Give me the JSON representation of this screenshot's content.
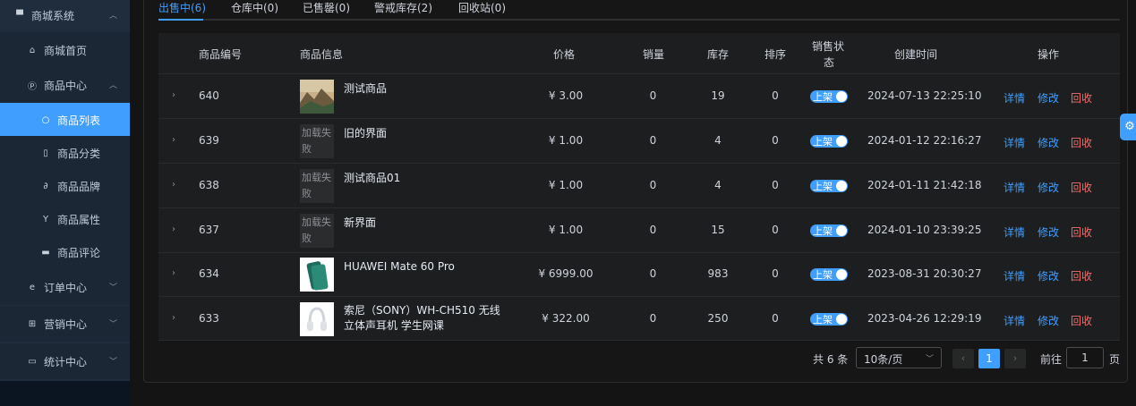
{
  "sidebar": {
    "items": [
      {
        "label": "商城系统",
        "icon": "store-icon",
        "chev": "⌃"
      },
      {
        "label": "商城首页",
        "icon": "home-icon"
      },
      {
        "label": "商品中心",
        "icon": "product-icon",
        "chev": "⌃"
      },
      {
        "label": "商品列表",
        "icon": "apple-icon"
      },
      {
        "label": "商品分类",
        "icon": "phone-icon"
      },
      {
        "label": "商品品牌",
        "icon": "link-icon"
      },
      {
        "label": "商品属性",
        "icon": "branch-icon"
      },
      {
        "label": "商品评论",
        "icon": "chat-icon"
      },
      {
        "label": "订单中心",
        "icon": "order-icon",
        "chev": "⌄"
      },
      {
        "label": "营销中心",
        "icon": "gift-icon",
        "chev": "⌄"
      },
      {
        "label": "统计中心",
        "icon": "monitor-icon",
        "chev": "⌄"
      }
    ],
    "active": "商品列表"
  },
  "tabs": [
    {
      "label": "出售中(6)",
      "active": true
    },
    {
      "label": "仓库中(0)",
      "active": false
    },
    {
      "label": "已售罄(0)",
      "active": false
    },
    {
      "label": "警戒库存(2)",
      "active": false
    },
    {
      "label": "回收站(0)",
      "active": false
    }
  ],
  "table": {
    "headers": {
      "id": "商品编号",
      "info": "商品信息",
      "price": "价格",
      "sales": "销量",
      "stock": "库存",
      "sort": "排序",
      "status_line1": "销售状",
      "status_line2": "态",
      "created": "创建时间",
      "actions": "操作"
    },
    "rows": [
      {
        "id": "640",
        "name": "测试商品",
        "img": "landscape",
        "price": "¥ 3.00",
        "sales": "0",
        "stock": "19",
        "sort": "0",
        "status": "上架",
        "created": "2024-07-13 22:25:10"
      },
      {
        "id": "639",
        "name": "旧的界面",
        "img": "fail",
        "price": "¥ 1.00",
        "sales": "0",
        "stock": "4",
        "sort": "0",
        "status": "上架",
        "created": "2024-01-12 22:16:27"
      },
      {
        "id": "638",
        "name": "测试商品01",
        "img": "fail",
        "price": "¥ 1.00",
        "sales": "0",
        "stock": "4",
        "sort": "0",
        "status": "上架",
        "created": "2024-01-11 21:42:18"
      },
      {
        "id": "637",
        "name": "新界面",
        "img": "fail",
        "price": "¥ 1.00",
        "sales": "0",
        "stock": "15",
        "sort": "0",
        "status": "上架",
        "created": "2024-01-10 23:39:25"
      },
      {
        "id": "634",
        "name": "HUAWEI Mate 60 Pro",
        "img": "phone",
        "price": "¥ 6999.00",
        "sales": "0",
        "stock": "983",
        "sort": "0",
        "status": "上架",
        "created": "2023-08-31 20:30:27"
      },
      {
        "id": "633",
        "name": "索尼（SONY）WH-CH510 无线立体声耳机 学生网课",
        "img": "headphones",
        "price": "¥ 322.00",
        "sales": "0",
        "stock": "250",
        "sort": "0",
        "status": "上架",
        "created": "2023-04-26 12:29:19"
      }
    ],
    "img_fail_text": "加载失败",
    "actions": {
      "detail": "详情",
      "edit": "修改",
      "recycle": "回收"
    }
  },
  "pagination": {
    "total": "共 6 条",
    "page_size": "10条/页",
    "current": "1",
    "goto_label": "前往",
    "goto_value": "1",
    "page_suffix": "页"
  },
  "colors": {
    "accent": "#409eff",
    "danger": "#f56c6c",
    "sidebar": "#1f2d3d"
  }
}
